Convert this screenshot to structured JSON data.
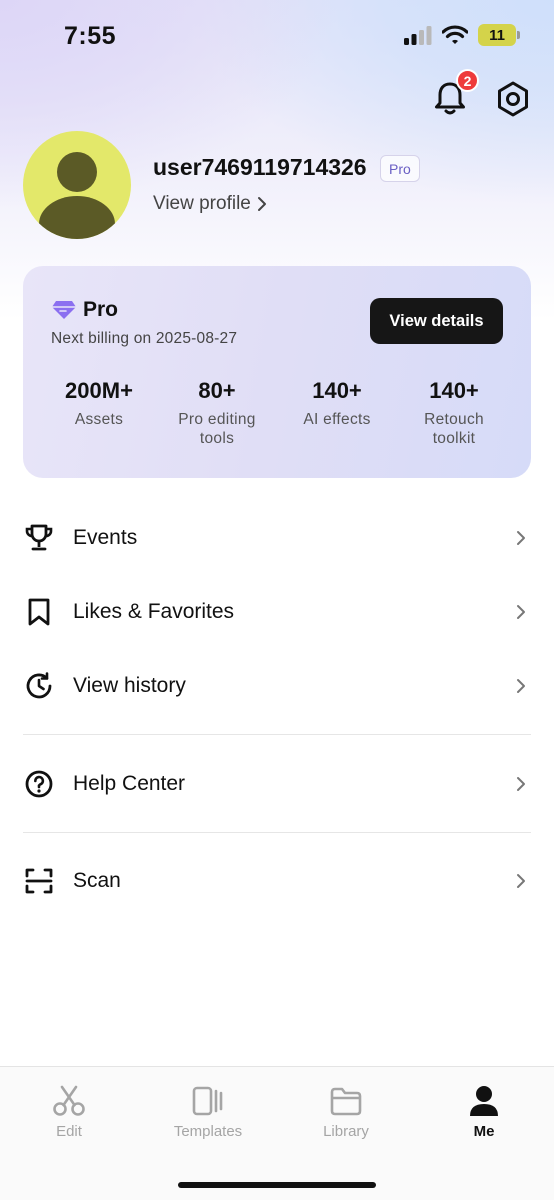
{
  "status_bar": {
    "time": "7:55",
    "battery": "11"
  },
  "header": {
    "notification_count": "2"
  },
  "profile": {
    "username": "user7469119714326",
    "badge": "Pro",
    "view_profile": "View profile"
  },
  "pro_card": {
    "title": "Pro",
    "billing": "Next billing on 2025-08-27",
    "button": "View details",
    "stats": [
      {
        "value": "200M+",
        "label": "Assets"
      },
      {
        "value": "80+",
        "label": "Pro editing tools"
      },
      {
        "value": "140+",
        "label": "AI effects"
      },
      {
        "value": "140+",
        "label": "Retouch toolkit"
      }
    ]
  },
  "menu": [
    {
      "label": "Events",
      "icon": "trophy-icon"
    },
    {
      "label": "Likes & Favorites",
      "icon": "bookmark-icon"
    },
    {
      "label": "View history",
      "icon": "history-icon"
    },
    {
      "label": "Help Center",
      "icon": "help-icon"
    },
    {
      "label": "Scan",
      "icon": "scan-icon"
    }
  ],
  "tabs": [
    {
      "label": "Edit",
      "icon": "scissors-icon",
      "active": false
    },
    {
      "label": "Templates",
      "icon": "templates-icon",
      "active": false
    },
    {
      "label": "Library",
      "icon": "folder-icon",
      "active": false
    },
    {
      "label": "Me",
      "icon": "person-icon",
      "active": true
    }
  ],
  "colors": {
    "accent": "#6a5fc4",
    "badge": "#ee3b3b",
    "avatar_bg": "#e3e86a",
    "avatar_figure": "#5b5a26",
    "button_dark": "#161616"
  }
}
